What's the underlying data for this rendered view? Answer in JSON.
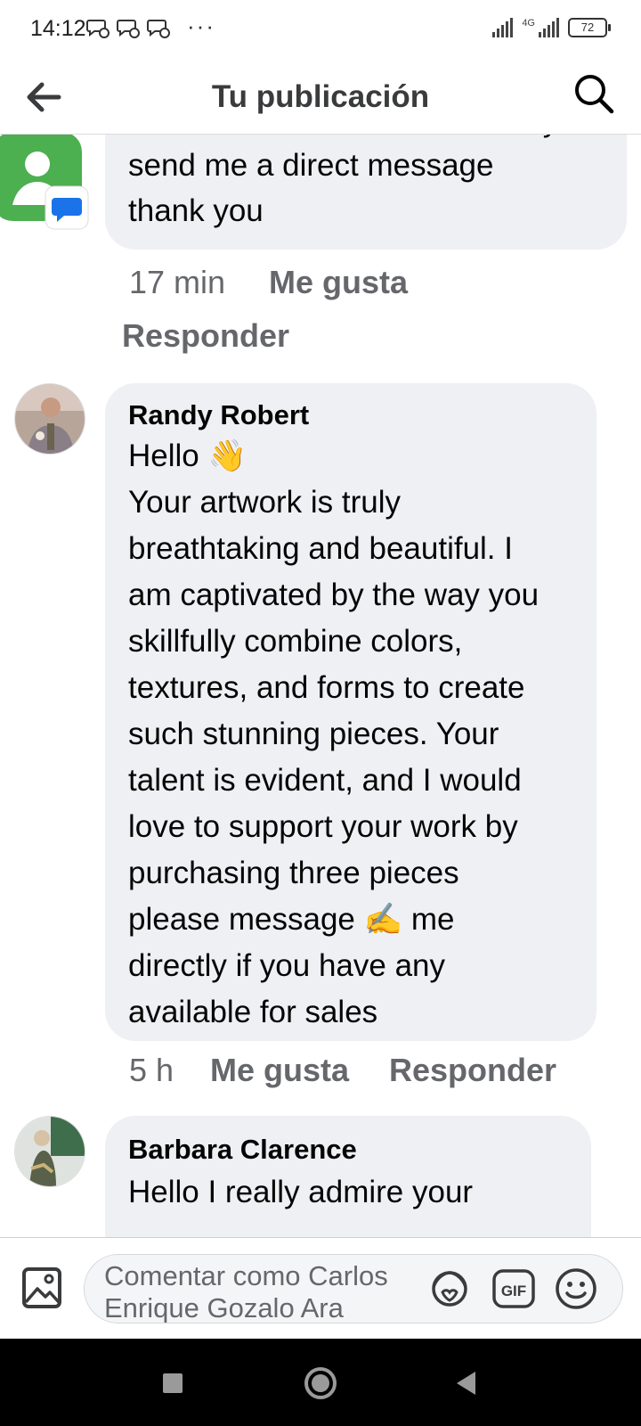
{
  "status": {
    "time": "14:12",
    "dots": "···",
    "network": "4G",
    "battery": "72"
  },
  "header": {
    "title": "Tu publicación"
  },
  "comments": [
    {
      "text_partial": "if it's available for sales? Kindly",
      "text_lines": [
        "send me a direct message",
        "thank you"
      ],
      "time": "17 min",
      "like_label": "Me gusta",
      "reply_label": "Responder"
    },
    {
      "author": "Randy Robert",
      "text_lines": [
        "Hello 👋",
        "Your artwork is truly",
        "breathtaking and beautiful. I",
        "am captivated by the way you",
        "skillfully combine colors,",
        "textures, and forms to create",
        "such stunning pieces. Your",
        "talent is evident, and I would",
        "love to support your work by",
        "purchasing three pieces",
        "please message ✍️ me",
        "directly if you have any",
        "available for sales"
      ],
      "time": "5 h",
      "like_label": "Me gusta",
      "reply_label": "Responder"
    },
    {
      "author": "Barbara Clarence",
      "text_first_line": "Hello I really admire your"
    }
  ],
  "composer": {
    "placeholder_line1": "Comentar como Carlos",
    "placeholder_line2": "Enrique Gozalo Ara",
    "icons": [
      "photo-icon",
      "avatar-sticker-icon",
      "gif-icon",
      "emoji-icon"
    ]
  },
  "colors": {
    "bubble": "#eff0f3",
    "meta_text": "#65676b",
    "title_text": "#3a3b3c",
    "google_green": "#4caf50"
  }
}
